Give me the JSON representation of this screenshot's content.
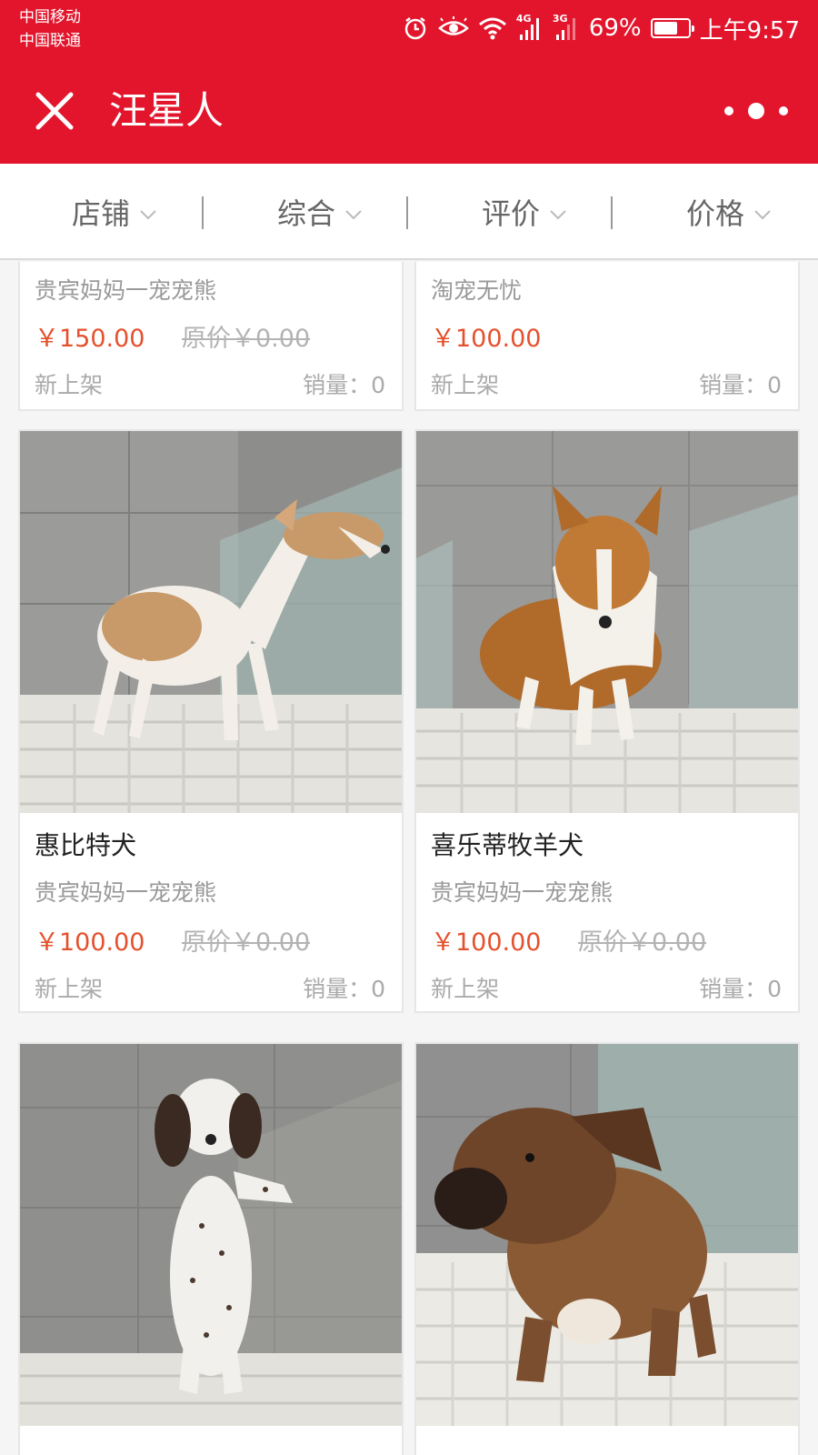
{
  "status_bar": {
    "carrier1": "中国移动",
    "carrier2": "中国联通",
    "net1": "4G",
    "net2": "3G",
    "battery_text": "69%",
    "battery_level": 0.69,
    "time": "上午9:57",
    "icons": [
      "alarm-icon",
      "eye-icon",
      "wifi-icon",
      "signal-icon",
      "battery-icon"
    ]
  },
  "header": {
    "title": "汪星人",
    "background": "#e2152c",
    "icons": [
      "close-icon",
      "more-icon"
    ]
  },
  "filters": [
    {
      "label": "店铺"
    },
    {
      "label": "综合"
    },
    {
      "label": "评价"
    },
    {
      "label": "价格"
    }
  ],
  "products": [
    {
      "name": "",
      "shop": "贵宾妈妈一宠宠熊",
      "price": "￥150.00",
      "original": "原价￥0.00",
      "tag": "新上架",
      "sales": "销量：0"
    },
    {
      "name": "",
      "shop": "淘宠无忧",
      "price": "￥100.00",
      "original": "",
      "tag": "新上架",
      "sales": "销量：0"
    },
    {
      "name": "惠比特犬",
      "shop": "贵宾妈妈一宠宠熊",
      "price": "￥100.00",
      "original": "原价￥0.00",
      "tag": "新上架",
      "sales": "销量：0"
    },
    {
      "name": "喜乐蒂牧羊犬",
      "shop": "贵宾妈妈一宠宠熊",
      "price": "￥100.00",
      "original": "原价￥0.00",
      "tag": "新上架",
      "sales": "销量：0"
    },
    {
      "name": "",
      "shop": "",
      "price": "",
      "original": "",
      "tag": "",
      "sales": ""
    },
    {
      "name": "",
      "shop": "",
      "price": "",
      "original": "",
      "tag": "",
      "sales": ""
    }
  ],
  "colors": {
    "accent": "#e2152c",
    "price": "#e4512d",
    "muted": "#999999"
  }
}
